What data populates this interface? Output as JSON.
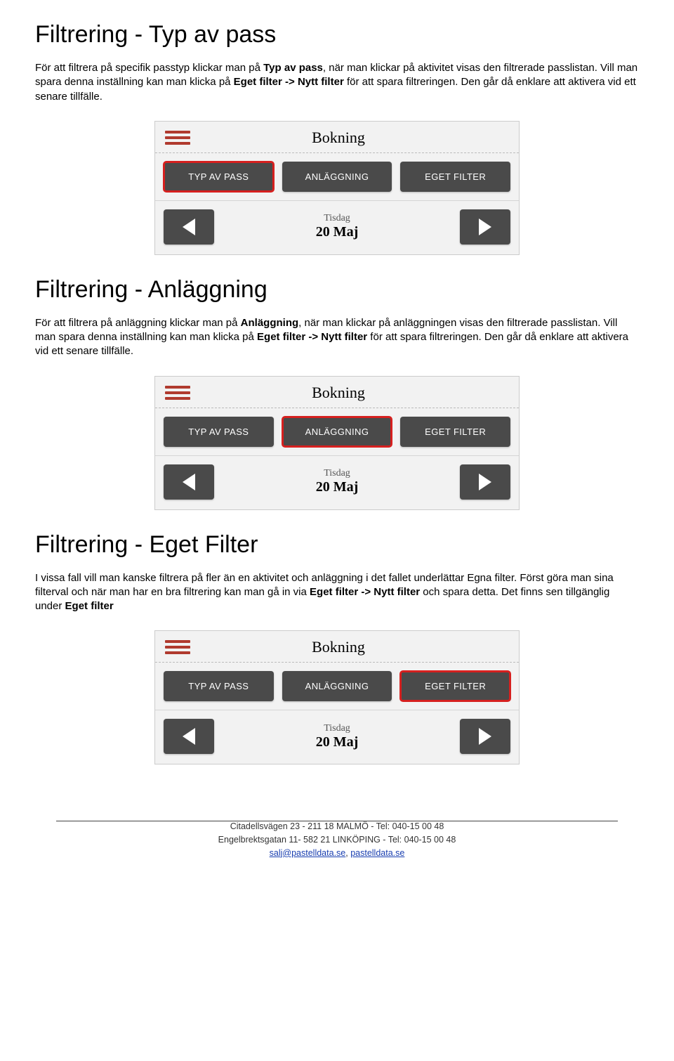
{
  "section1": {
    "heading": "Filtrering - Typ av pass",
    "p1a": "För att filtrera på specifik passtyp klickar man på ",
    "p1b": "Typ av pass",
    "p1c": ", när man klickar på aktivitet visas den filtrerade passlistan. Vill man spara denna inställning kan man klicka på ",
    "p1d": "Eget filter -> Nytt filter",
    "p1e": " för att spara filtreringen. Den går då enklare att aktivera vid ett senare tillfälle."
  },
  "section2": {
    "heading": "Filtrering - Anläggning",
    "p1a": "För att filtrera på anläggning klickar man på ",
    "p1b": "Anläggning",
    "p1c": ", när man klickar på anläggningen visas den filtrerade passlistan. Vill man spara denna inställning kan man klicka på ",
    "p1d": "Eget filter -> Nytt filter",
    "p1e": " för att spara filtreringen. Den går då enklare att aktivera vid ett senare tillfälle."
  },
  "section3": {
    "heading": "Filtrering - Eget Filter",
    "p1a": "I vissa fall vill man kanske filtrera på fler än en aktivitet och anläggning i det fallet underlättar Egna filter. Först göra man sina filterval och när man har en bra filtrering kan man gå in via ",
    "p1b": "Eget filter -> Nytt filter",
    "p1c": " och spara detta. Det finns sen tillgänglig under ",
    "p1d": "Eget filter"
  },
  "widget": {
    "title": "Bokning",
    "tabs": [
      "TYP AV PASS",
      "ANLÄGGNING",
      "EGET FILTER"
    ],
    "day": "Tisdag",
    "date": "20 Maj"
  },
  "footer": {
    "line1": "Citadellsvägen 23 - 211 18 MALMÖ - Tel: 040-15 00 48",
    "line2": "Engelbrektsgatan 11- 582 21 LINKÖPING - Tel: 040-15 00 48",
    "email": "salj@pastelldata.se",
    "sep": ", ",
    "site": "pastelldata.se"
  }
}
